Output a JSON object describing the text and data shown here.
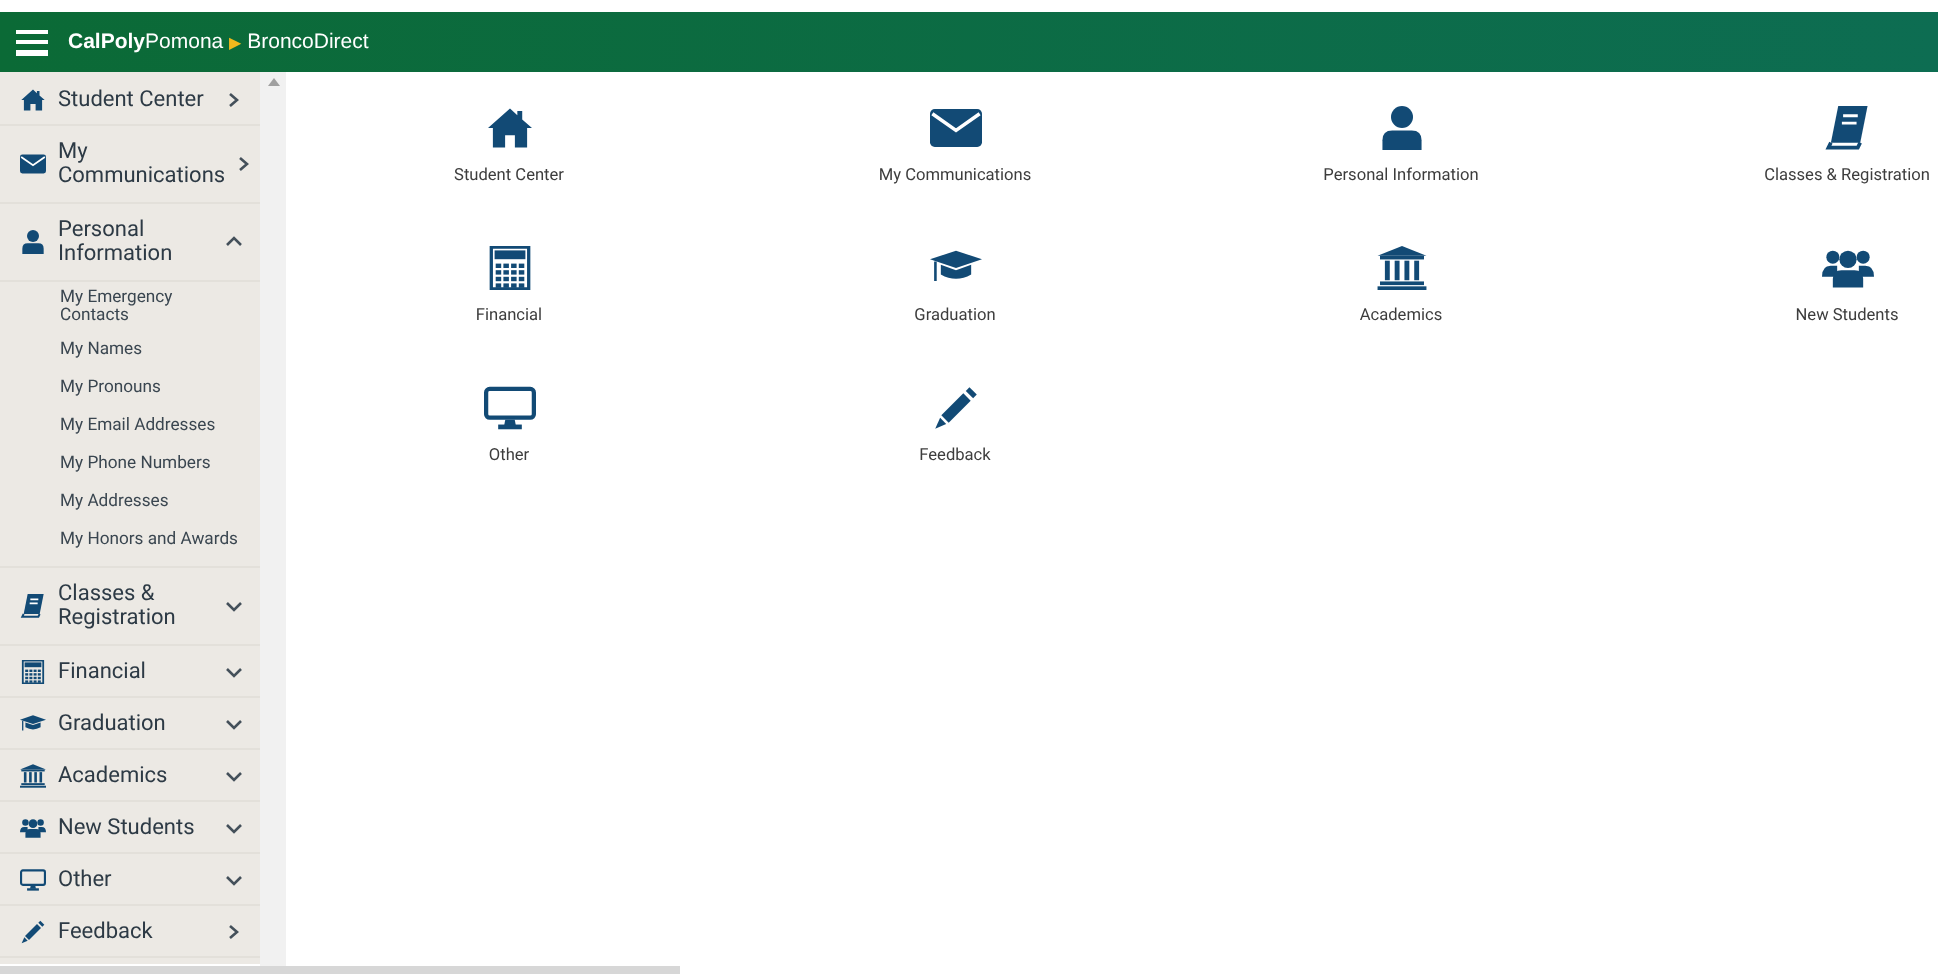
{
  "header": {
    "brand_bold": "CalPoly",
    "brand_rest": "Pomona",
    "separator": "▶",
    "app": "BroncoDirect"
  },
  "sidebar": {
    "items": [
      {
        "label": "Student Center",
        "kind": "link"
      },
      {
        "label": "My Communications",
        "kind": "link"
      },
      {
        "label": "Personal Information",
        "kind": "group",
        "expanded": true,
        "children": [
          {
            "label": "My Emergency Contacts"
          },
          {
            "label": "My Names"
          },
          {
            "label": "My Pronouns"
          },
          {
            "label": "My Email Addresses"
          },
          {
            "label": "My Phone Numbers"
          },
          {
            "label": "My Addresses"
          },
          {
            "label": "My Honors and Awards"
          }
        ]
      },
      {
        "label": "Classes & Registration",
        "kind": "group",
        "expanded": false
      },
      {
        "label": "Financial",
        "kind": "group",
        "expanded": false
      },
      {
        "label": "Graduation",
        "kind": "group",
        "expanded": false
      },
      {
        "label": "Academics",
        "kind": "group",
        "expanded": false
      },
      {
        "label": "New Students",
        "kind": "group",
        "expanded": false
      },
      {
        "label": "Other",
        "kind": "group",
        "expanded": false
      },
      {
        "label": "Feedback",
        "kind": "link"
      }
    ]
  },
  "tiles": [
    {
      "label": "Student Center"
    },
    {
      "label": "My Communications"
    },
    {
      "label": "Personal Information"
    },
    {
      "label": "Classes & Registration"
    },
    {
      "label": "Financial"
    },
    {
      "label": "Graduation"
    },
    {
      "label": "Academics"
    },
    {
      "label": "New Students"
    },
    {
      "label": "Other"
    },
    {
      "label": "Feedback"
    }
  ]
}
